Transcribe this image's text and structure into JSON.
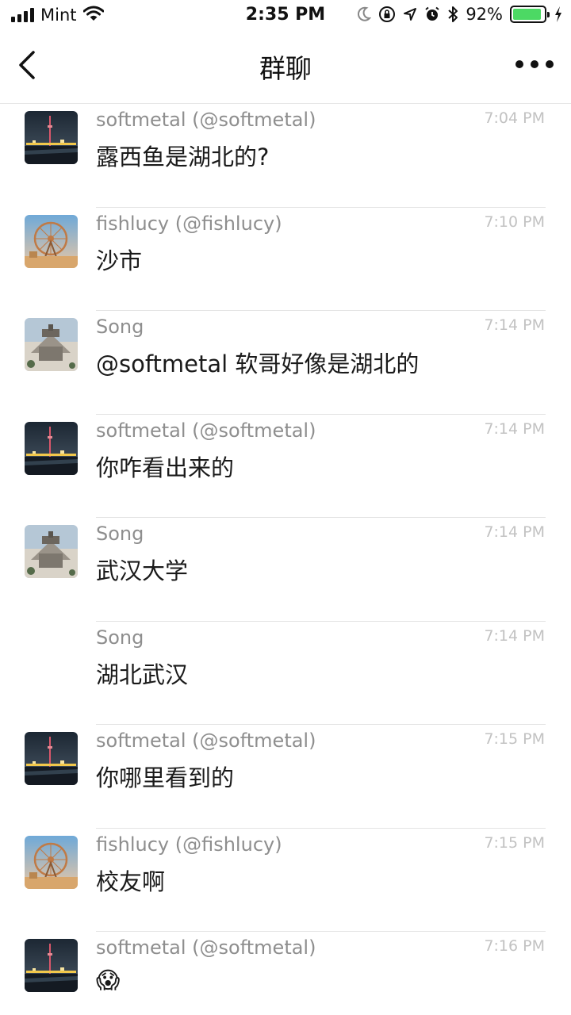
{
  "status_bar": {
    "carrier": "Mint",
    "time": "2:35 PM",
    "battery_percent": "92%",
    "battery_level": 0.92,
    "icons": [
      "signal-icon",
      "wifi-icon",
      "moon-icon",
      "orientation-lock-icon",
      "location-icon",
      "alarm-icon",
      "bluetooth-icon",
      "battery-icon",
      "charging-icon"
    ]
  },
  "nav": {
    "title": "群聊",
    "back_icon": "chevron-left-icon",
    "more_icon": "more-icon"
  },
  "colors": {
    "battery_fill": "#4cd964",
    "sender_text": "#8e8e8e",
    "timestamp_text": "#c2c2c2"
  },
  "messages": [
    {
      "sender": "softmetal (@softmetal)",
      "time": "7:04 PM",
      "text": "露西鱼是湖北的?",
      "avatar": "avatar-softmetal"
    },
    {
      "sender": "fishlucy (@fishlucy)",
      "time": "7:10 PM",
      "text": "沙市",
      "avatar": "avatar-fishlucy"
    },
    {
      "sender": "Song",
      "time": "7:14 PM",
      "text": "@softmetal 软哥好像是湖北的",
      "avatar": "avatar-song"
    },
    {
      "sender": "softmetal (@softmetal)",
      "time": "7:14 PM",
      "text": "你咋看出来的",
      "avatar": "avatar-softmetal"
    },
    {
      "sender": "Song",
      "time": "7:14 PM",
      "text": "武汉大学",
      "avatar": "avatar-song"
    },
    {
      "sender": "Song",
      "time": "7:14 PM",
      "text": "湖北武汉",
      "avatar": ""
    },
    {
      "sender": "softmetal (@softmetal)",
      "time": "7:15 PM",
      "text": "你哪里看到的",
      "avatar": "avatar-softmetal"
    },
    {
      "sender": "fishlucy (@fishlucy)",
      "time": "7:15 PM",
      "text": "校友啊",
      "avatar": "avatar-fishlucy"
    },
    {
      "sender": "softmetal (@softmetal)",
      "time": "7:16 PM",
      "text": "😱",
      "avatar": "avatar-softmetal"
    }
  ]
}
